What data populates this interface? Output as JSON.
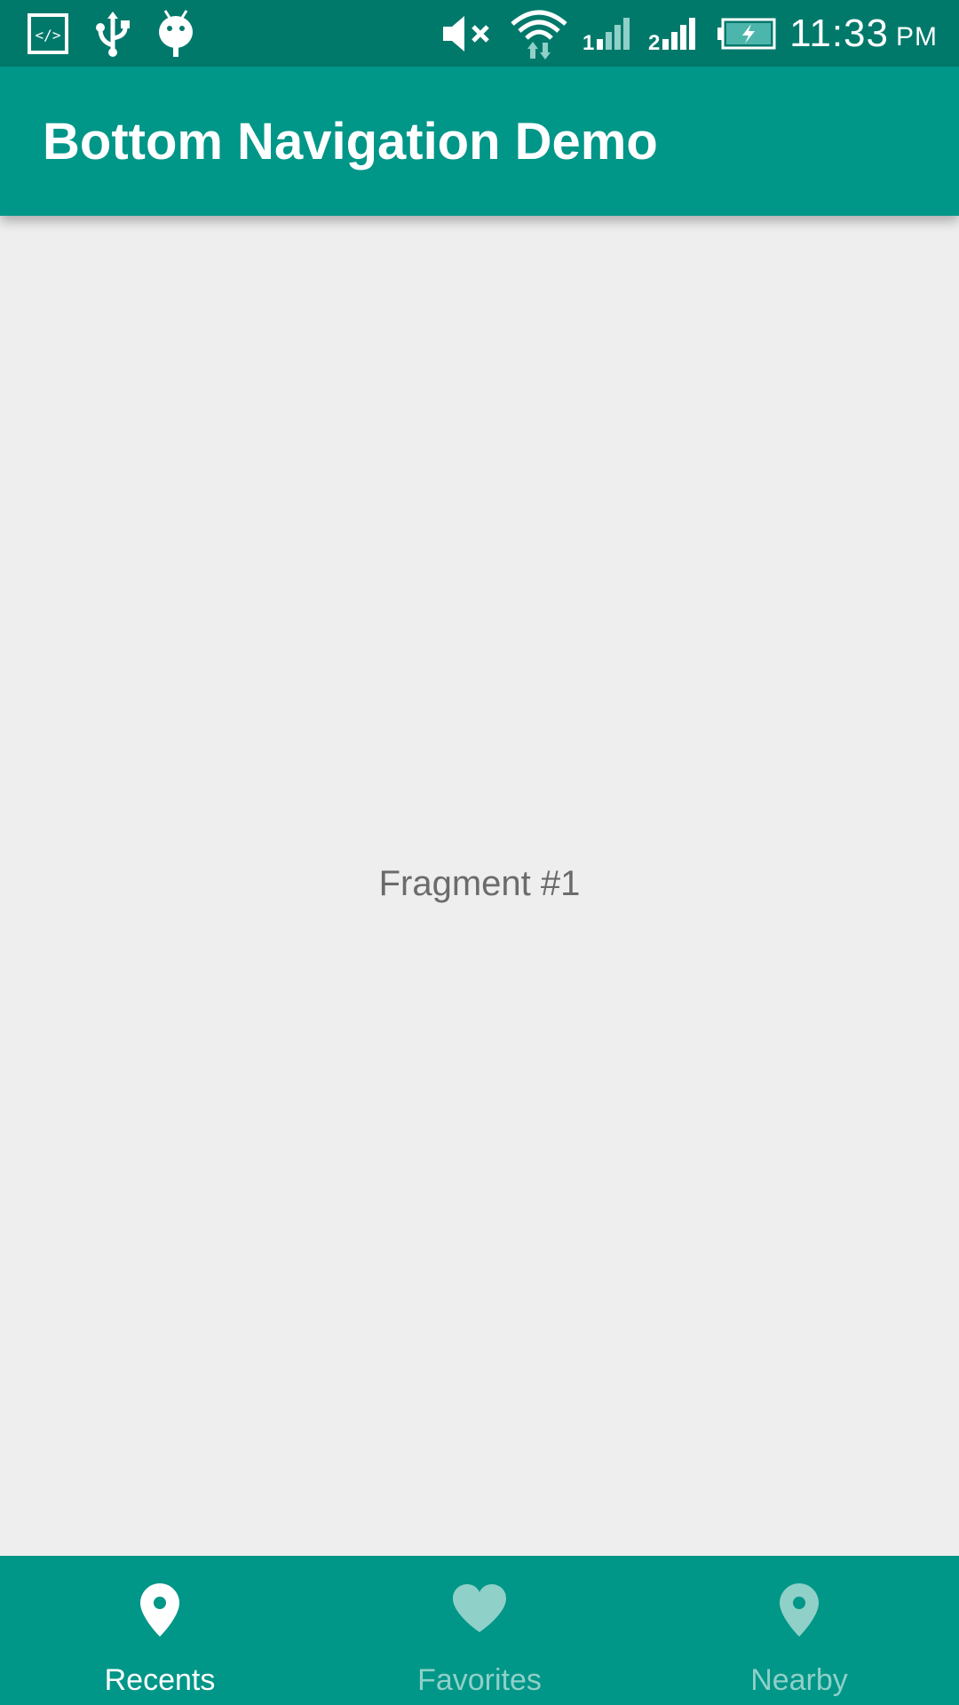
{
  "status_bar": {
    "time": "11:33",
    "ampm": "PM",
    "icons": [
      "code-icon",
      "usb-icon",
      "android-debug-icon",
      "mute-icon",
      "wifi-icon",
      "signal-sim1-icon",
      "signal-sim2-icon",
      "battery-charging-icon"
    ]
  },
  "app_bar": {
    "title": "Bottom Navigation Demo"
  },
  "content": {
    "fragment_text": "Fragment #1"
  },
  "bottom_nav": {
    "items": [
      {
        "label": "Recents",
        "icon": "location-pin-icon",
        "active": true
      },
      {
        "label": "Favorites",
        "icon": "heart-icon",
        "active": false
      },
      {
        "label": "Nearby",
        "icon": "location-pin-icon",
        "active": false
      }
    ]
  },
  "colors": {
    "status_bar": "#00796b",
    "primary": "#009688",
    "background": "#eeeeee",
    "active_item": "#ffffff",
    "inactive_item": "#8fd0c8",
    "body_text": "#6b6b6b"
  }
}
